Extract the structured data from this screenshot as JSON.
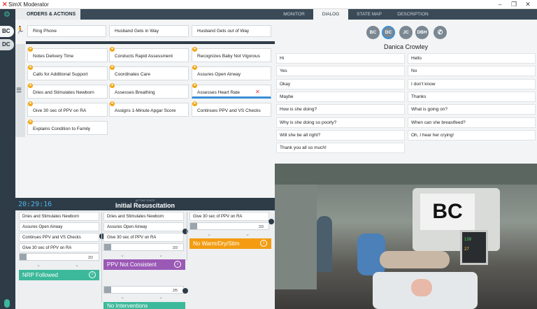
{
  "window": {
    "title": "SimX Moderator",
    "minimize": "–",
    "maximize": "❐",
    "close": "✕"
  },
  "rail": {
    "settings_icon": "gear-icon",
    "participants": [
      "BC",
      "DC"
    ]
  },
  "left_tabs": {
    "active": "ORDERS & ACTIONS"
  },
  "quick_actions": [
    "Ring Phone",
    "Husband Gets in Way",
    "Husband Gets out of Way"
  ],
  "actions": [
    "Notes Delivery Time",
    "Conducts Rapid Assessment",
    "Recognizes Baby Not Vigorous",
    "Calls for Additional Support",
    "Coordinates Care",
    "Assures Open Airway",
    "Dries and Stimulates Newborn",
    "Assesses Breathing",
    "Assesses Heart Rate",
    "Give 30 sec of PPV on RA",
    "Assigns 1-Minute Apgar Score",
    "Continues PPV and VS Checks",
    "Explains Condition to Family"
  ],
  "state": {
    "timer": "20:29:16",
    "active_label": "ACTIVE STATE",
    "name": "Initial Resuscitation",
    "col1": [
      "Dries and Stimulates Newborn",
      "Assures Open Airway",
      "Continues PPV and VS Checks",
      "Give 30 sec of PPV on RA"
    ],
    "col1_bar": "2/2",
    "col1_button": "NRP Followed",
    "col2": [
      "Dries and Stimulates Newborn",
      "Assures Open Airway",
      "Give 30 sec of PPV on RA"
    ],
    "col2_bar": "2/3",
    "col2_button": "PPV Not Consistent",
    "col2b_bar": "2/5",
    "col2b_button": "No Interventions",
    "col3": [
      "Give 30 sec of PPV on RA"
    ],
    "col3_bar": "2/3",
    "col3_button": "No Warm/Dry/Stim",
    "badges": [
      "4",
      "4",
      "4",
      "4"
    ]
  },
  "right_tabs": [
    "MONITOR",
    "DIALOG",
    "STATE MAP",
    "DESCRIPTION"
  ],
  "avatars": [
    "BC",
    "DC",
    "JC",
    "DBH"
  ],
  "selected_person": "Danica Crowley",
  "dialog_left": [
    "Hi",
    "Yes",
    "Okay",
    "Maybe",
    "How is she doing?",
    "Why is she doing so poorly?",
    "Will she be all right?",
    "Thank you all so much!"
  ],
  "dialog_right": [
    "Hello",
    "No",
    "I don't know",
    "Thanks",
    "What is going on?",
    "When can she breastfeed?",
    "Oh, I hear her crying!"
  ],
  "scene": {
    "sign": "BC",
    "monitor_values": [
      "139",
      "27"
    ]
  },
  "colors": {
    "dark": "#2e3c48",
    "green": "#3cb99a",
    "purple": "#9b59b6",
    "orange": "#f39c12",
    "blue": "#3b8fd6"
  }
}
